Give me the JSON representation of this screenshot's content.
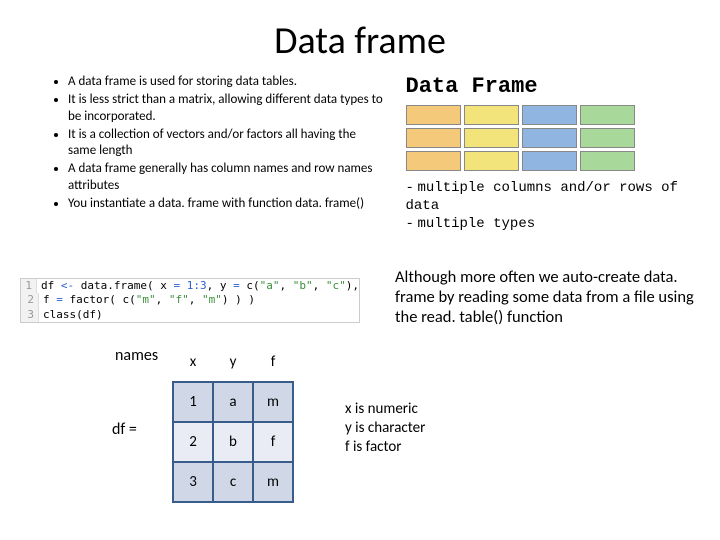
{
  "title": "Data frame",
  "bullets": [
    "A data frame is used for storing data tables.",
    "It is less strict than a matrix, allowing different data types to be incorporated.",
    "It is a collection of vectors and/or factors all having the same length",
    "A data frame generally has column names and row names attributes",
    "You instantiate a data. frame with function data. frame()"
  ],
  "diagram": {
    "heading": "Data Frame",
    "note1": "multiple columns and/or rows of data",
    "note2": "multiple types"
  },
  "code": {
    "lines": [
      {
        "n": "1",
        "text": "df <- data.frame( x = 1:3, y = c(\"a\", \"b\", \"c\"),"
      },
      {
        "n": "2",
        "text": "f = factor( c(\"m\", \"f\", \"m\") ) )"
      },
      {
        "n": "3",
        "text": "class(df)"
      }
    ]
  },
  "paragraph": "Although more often we auto-create data. frame by reading some data from a file using the read. table() function",
  "table": {
    "names_label": "names",
    "df_label": "df =",
    "headers": [
      "x",
      "y",
      "f"
    ],
    "rows": [
      [
        "1",
        "a",
        "m"
      ],
      [
        "2",
        "b",
        "f"
      ],
      [
        "3",
        "c",
        "m"
      ]
    ]
  },
  "type_notes": {
    "l1": "x is numeric",
    "l2": "y is character",
    "l3": "f is factor"
  }
}
